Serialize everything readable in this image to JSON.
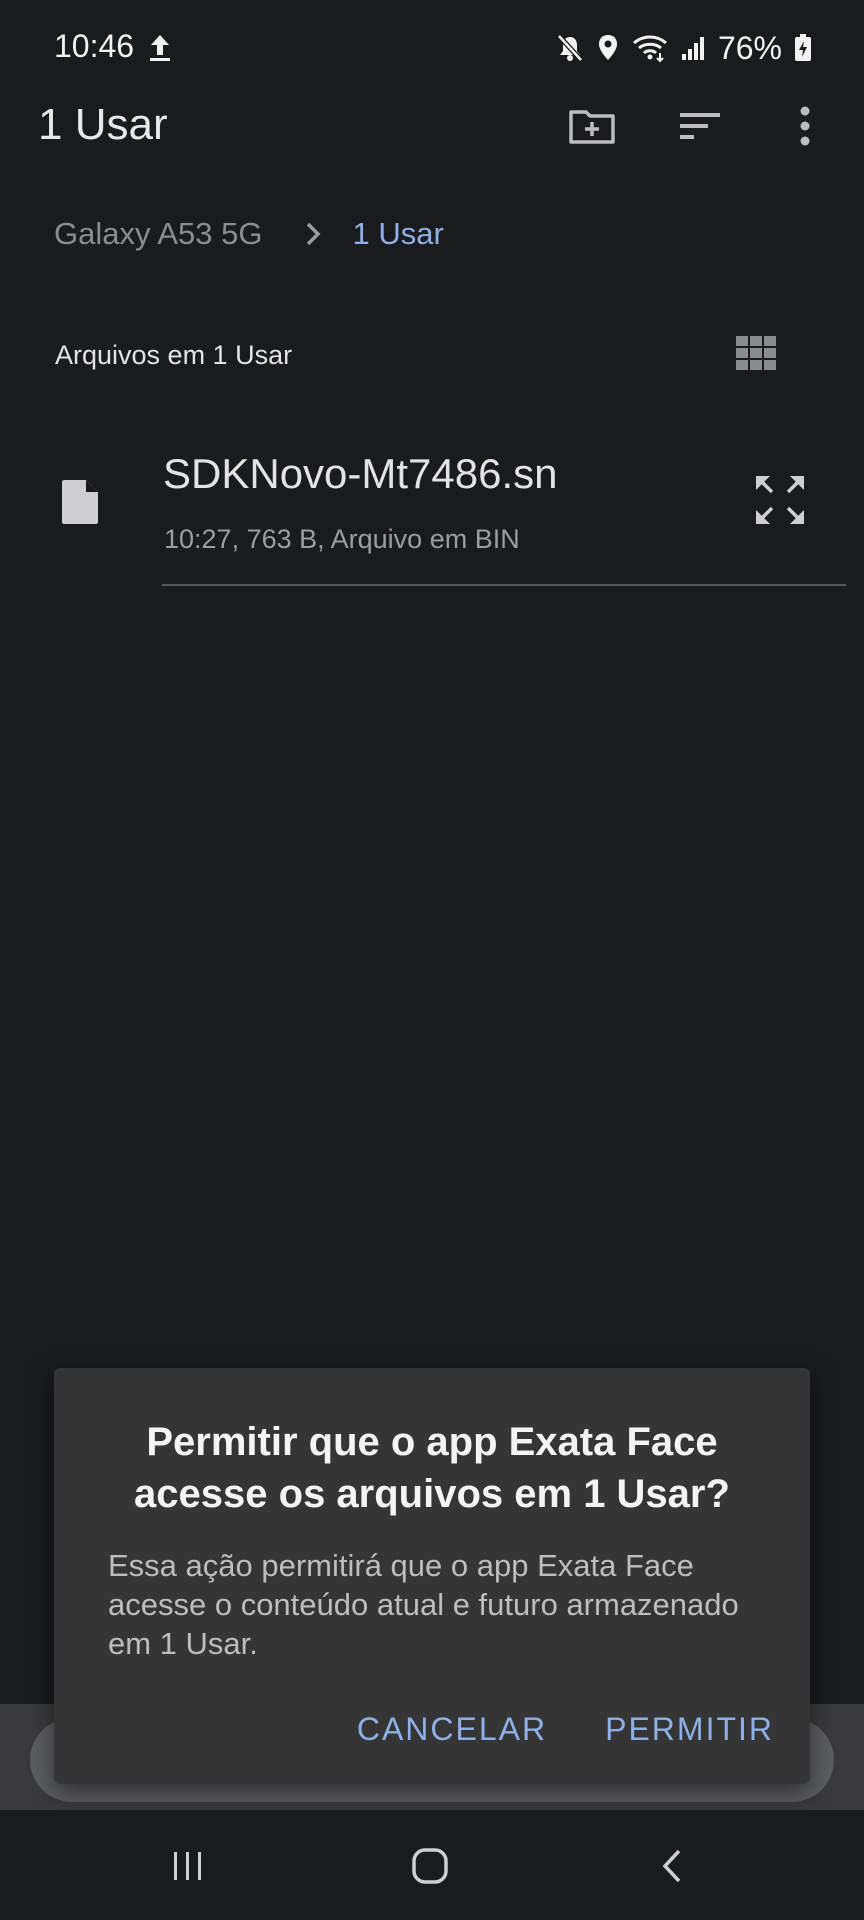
{
  "status_bar": {
    "time": "10:46",
    "battery_percent": "76%",
    "icons": [
      "upload-icon",
      "mute-icon",
      "location-icon",
      "wifi-icon",
      "signal-icon",
      "battery-charging-icon"
    ]
  },
  "appbar": {
    "title": "1 Usar",
    "actions": [
      "new-folder-icon",
      "sort-icon",
      "more-options-icon"
    ]
  },
  "breadcrumb": {
    "root": "Galaxy A53 5G",
    "current": "1 Usar"
  },
  "section": {
    "title": "Arquivos em 1 Usar",
    "view_toggle_icon": "grid-view-icon"
  },
  "files": [
    {
      "name": "SDKNovo-Mt7486.sn",
      "meta": "10:27, 763 B, Arquivo em BIN",
      "icon": "file-icon"
    }
  ],
  "dialog": {
    "title": "Permitir que o app Exata Face acesse os arquivos em 1 Usar?",
    "body": "Essa ação permitirá que o app Exata Face acesse o conteúdo atual e futuro armazenado em 1 Usar.",
    "cancel_label": "CANCELAR",
    "allow_label": "PERMITIR"
  },
  "colors": {
    "background": "#1a1b1f",
    "accent": "#8fb0e6",
    "dialog_bg": "#353535"
  },
  "navbar": {
    "buttons": [
      "recents-icon",
      "home-icon",
      "back-icon"
    ]
  }
}
